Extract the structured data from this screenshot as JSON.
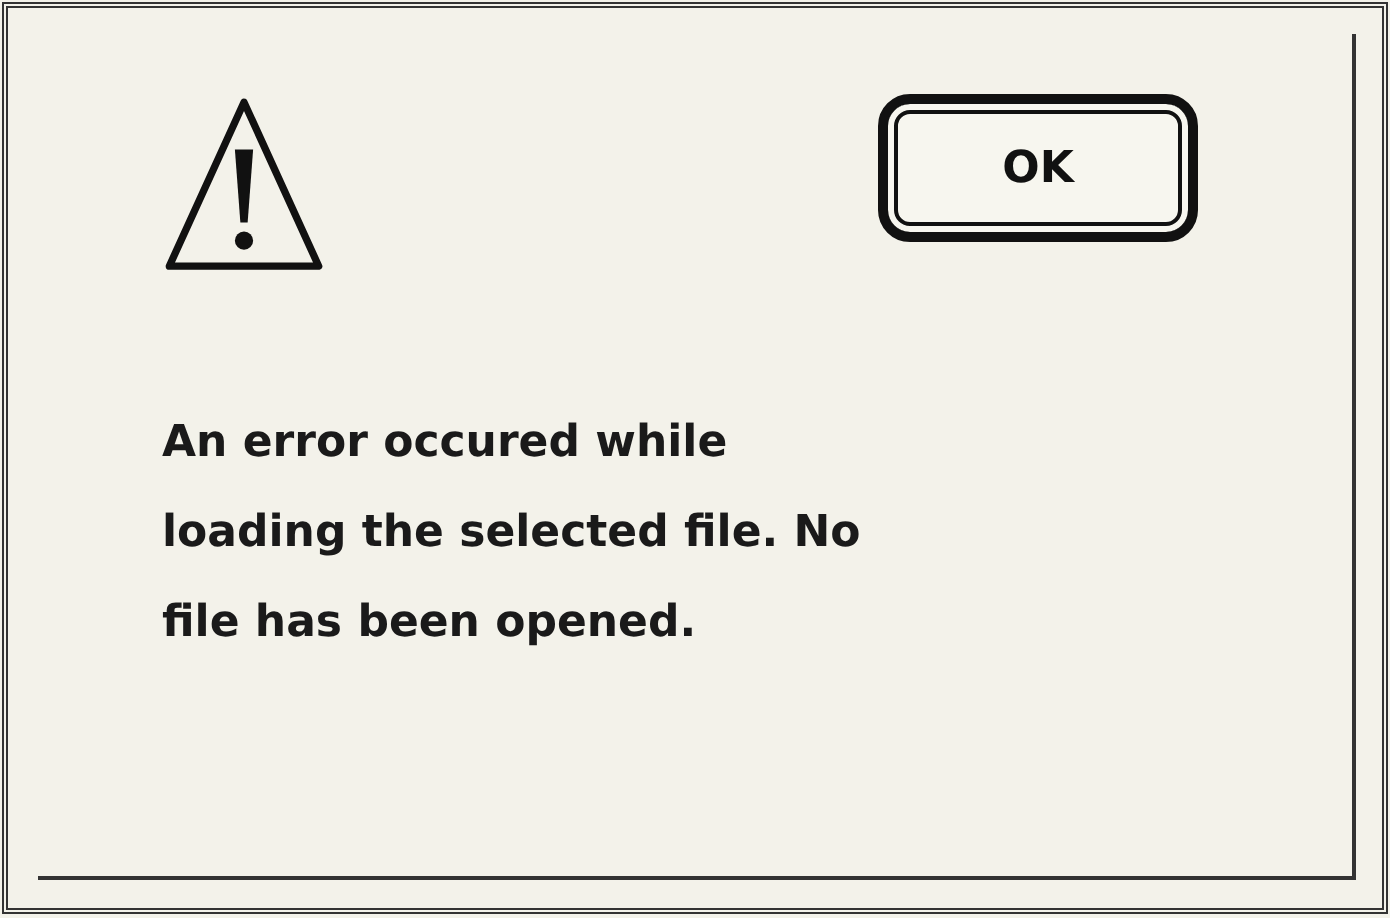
{
  "alert": {
    "button": {
      "label": "OK",
      "default": true
    },
    "message": "An error occured while loading the selected file. No file has been opened."
  }
}
